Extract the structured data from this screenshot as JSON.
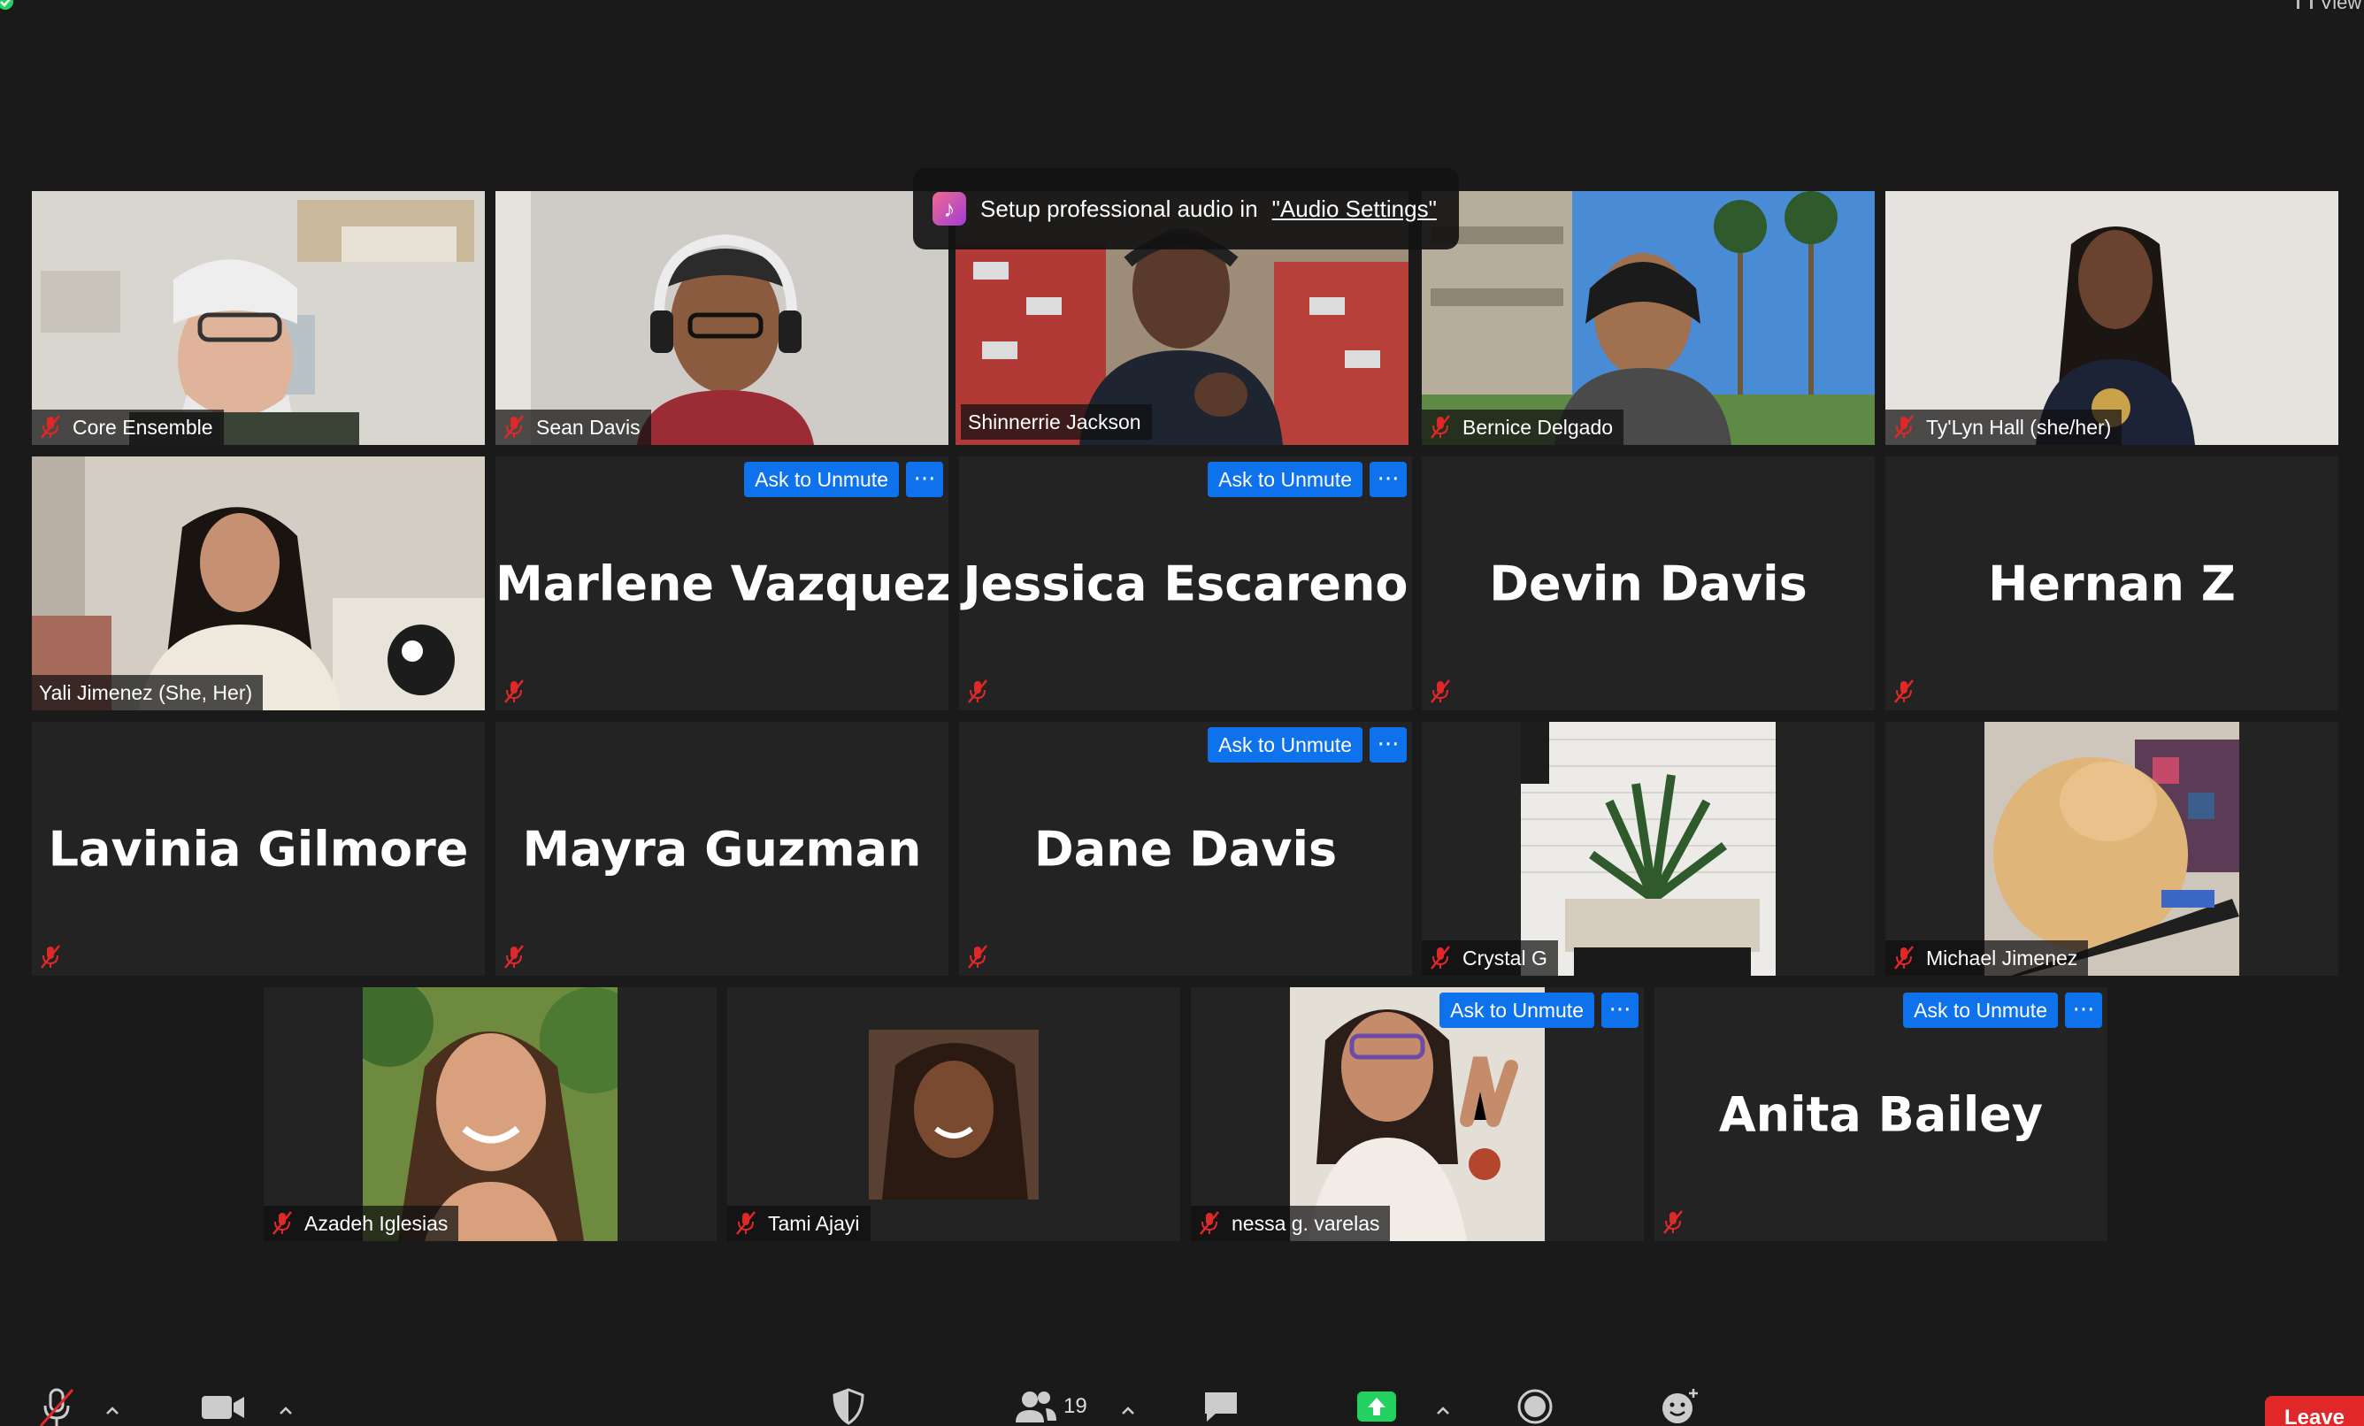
{
  "meeting": {
    "view_label": "View",
    "toast": {
      "text": "Setup professional audio in",
      "link": "\"Audio Settings\""
    }
  },
  "tile_actions": {
    "ask_to_unmute": "Ask to Unmute",
    "more": "···"
  },
  "participants": [
    {
      "name": "Core Ensemble",
      "video": true
    },
    {
      "name": "Sean Davis",
      "video": true
    },
    {
      "name": "Shinnerrie Jackson",
      "video": true,
      "speaking": true
    },
    {
      "name": "Bernice Delgado",
      "video": true
    },
    {
      "name": "Ty'Lyn Hall (she/her)",
      "video": true
    },
    {
      "name": "Yali Jimenez (She, Her)",
      "video": true
    },
    {
      "name": "Marlene Vazquez",
      "video": false
    },
    {
      "name": "Jessica Escareno",
      "video": false
    },
    {
      "name": "Devin Davis",
      "video": false
    },
    {
      "name": "Hernan Z",
      "video": false
    },
    {
      "name": "Lavinia Gilmore",
      "video": false
    },
    {
      "name": "Mayra Guzman",
      "video": false
    },
    {
      "name": "Dane Davis",
      "video": false
    },
    {
      "name": "Crystal G",
      "video": true
    },
    {
      "name": "Michael Jimenez",
      "video": true
    },
    {
      "name": "Azadeh Iglesias",
      "video": true
    },
    {
      "name": "Tami Ajayi",
      "video": true
    },
    {
      "name": "nessa g. varelas",
      "video": true
    },
    {
      "name": "Anita Bailey",
      "video": false
    }
  ],
  "toolbar": {
    "participants_count": "19",
    "leave_label": "Leave"
  },
  "colors": {
    "accent": "#0e72ed",
    "speaking": "#d8f236",
    "leave": "#e02828",
    "muted": "#e02828"
  }
}
